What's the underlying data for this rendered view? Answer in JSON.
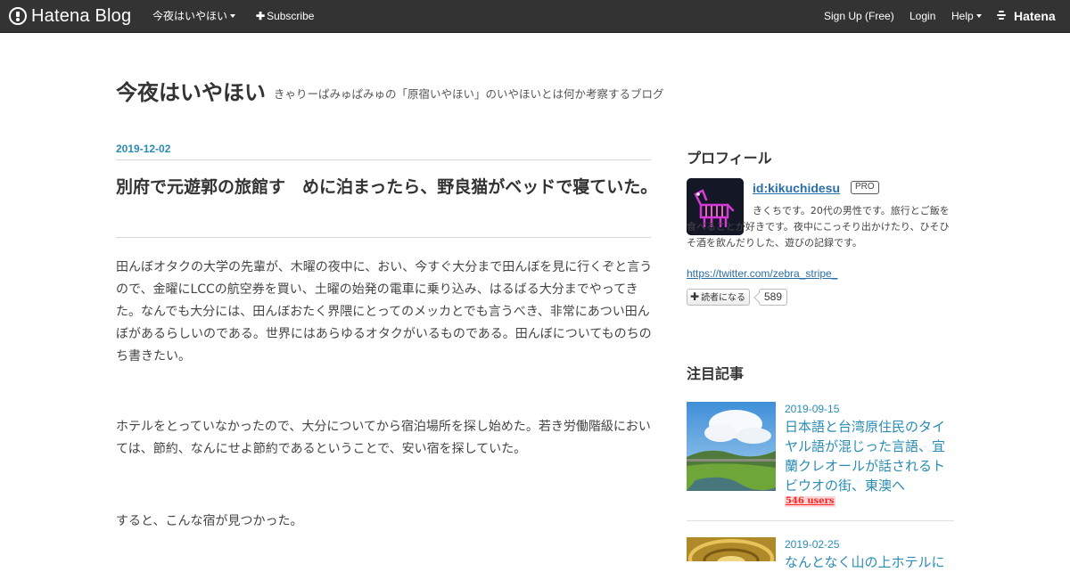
{
  "topbar": {
    "brand": "Hatena Blog",
    "blog_menu": "今夜はいやほい",
    "subscribe": "Subscribe",
    "signup": "Sign Up (Free)",
    "login": "Login",
    "help": "Help",
    "hatena": "Hatena"
  },
  "blog": {
    "title": "今夜はいやほい",
    "description": "きゃりーぱみゅぱみゅの「原宿いやほい」のいやほいとは何か考察するブログ"
  },
  "article": {
    "date": "2019-12-02",
    "title": "別府で元遊郭の旅館す　めに泊まったら、野良猫がベッドで寝ていた。",
    "paragraphs": [
      "田んぼオタクの大学の先輩が、木曜の夜中に、おい、今すぐ大分まで田んぼを見に行くぞと言うので、金曜にLCCの航空券を買い、土曜の始発の電車に乗り込み、はるばる大分までやってきた。なんでも大分には、田んぼおたく界隈にとってのメッカとでも言うべき、非常にあつい田んぼがあるらしいのである。世界にはあらゆるオタクがいるものである。田んぼについてものちのち書きたい。",
      "ホテルをとっていなかったので、大分についてから宿泊場所を探し始めた。若き労働階級においては、節約、なんにせよ節約であるということで、安い宿を探していた。",
      "すると、こんな宿が見つかった。"
    ]
  },
  "sidebar": {
    "profile_heading": "プロフィール",
    "profile_id": "id:kikuchidesu",
    "pro_badge": "PRO",
    "profile_desc": "きくちです。20代の男性です。旅行とご飯を食べることが好きです。夜中にこっそり出かけたり、ひそひそ酒を飲んだりした、遊びの記録です。",
    "profile_link": "https://twitter.com/zebra_stripe_",
    "subscribe_label": "読者になる",
    "reader_count": "589",
    "featured_heading": "注目記事",
    "entries": [
      {
        "date": "2019-09-15",
        "title": "日本語と台湾原住民のタイヤル語が混じった言語、宜蘭クレオールが話されるトビウオの街、東澳へ",
        "users": "546 users"
      },
      {
        "date": "2019-02-25",
        "title": "なんとなく山の上ホテルに"
      }
    ]
  },
  "colors": {
    "topbar_bg": "#333333",
    "link_blue": "#2a8cb4",
    "bookmark_red": "#ff2222"
  }
}
